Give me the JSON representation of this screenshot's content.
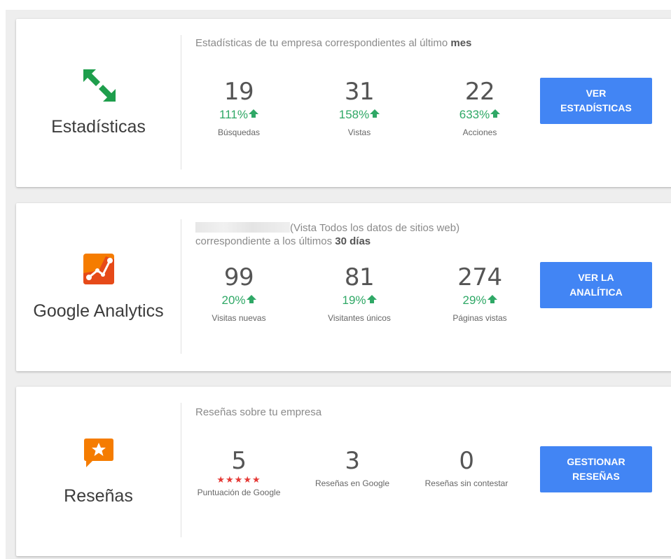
{
  "cards": [
    {
      "title": "Estadísticas",
      "subtitle_prefix": "Estadísticas de tu empresa correspondientes al último ",
      "subtitle_bold": "mes",
      "metrics": [
        {
          "value": "19",
          "change": "111%",
          "label": "Búsquedas"
        },
        {
          "value": "31",
          "change": "158%",
          "label": "Vistas"
        },
        {
          "value": "22",
          "change": "633%",
          "label": "Acciones"
        }
      ],
      "button_label": "VER ESTADÍSTICAS",
      "icon": "arrows-exchange-icon",
      "icon_color": "#1e9e4c"
    },
    {
      "title": "Google Analytics",
      "subtitle_line1": "(Vista Todos los datos de sitios web)",
      "subtitle_line2_prefix": "correspondiente a los últimos ",
      "subtitle_line2_bold": "30 días",
      "metrics": [
        {
          "value": "99",
          "change": "20%",
          "label": "Visitas nuevas"
        },
        {
          "value": "81",
          "change": "19%",
          "label": "Visitantes únicos"
        },
        {
          "value": "274",
          "change": "29%",
          "label": "Páginas vistas"
        }
      ],
      "button_label": "VER LA ANALÍTICA",
      "icon": "analytics-logo-icon",
      "icon_color": "#f57c00"
    },
    {
      "title": "Reseñas",
      "subtitle": "Reseñas sobre tu empresa",
      "metrics": [
        {
          "value": "5",
          "stars": "★★★★★",
          "label": "Puntuación de Google"
        },
        {
          "value": "3",
          "label": "Reseñas en Google"
        },
        {
          "value": "0",
          "label": "Reseñas sin contestar"
        }
      ],
      "button_label": "GESTIONAR RESEÑAS",
      "icon": "review-star-bubble-icon",
      "icon_color": "#f57c00"
    }
  ],
  "colors": {
    "accent": "#4285f4",
    "positive": "#2fa866",
    "stars": "#e53935"
  }
}
